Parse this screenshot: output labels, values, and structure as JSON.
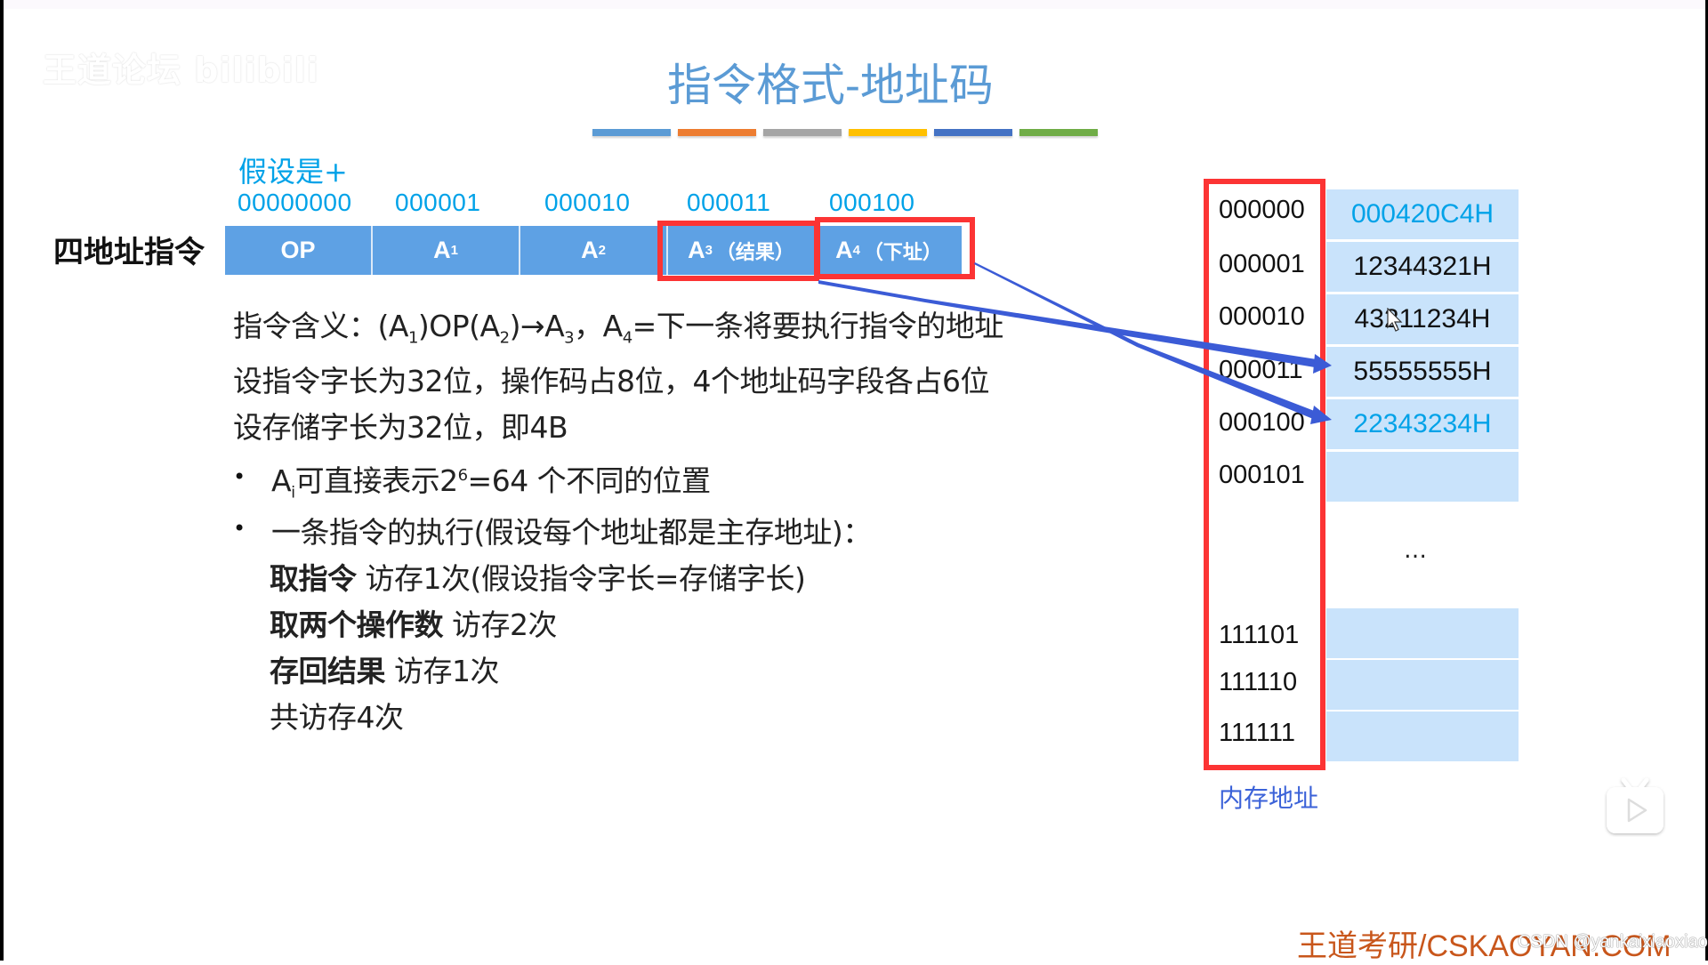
{
  "watermark_logo": "王道论坛 bilibili",
  "title": "指令格式-地址码",
  "color_bars": [
    "#5b9bd5",
    "#ed7d31",
    "#a5a5a5",
    "#ffc000",
    "#4472c4",
    "#70ad47"
  ],
  "instruction": {
    "assume_label": "假设是+",
    "row_label": "四地址指令",
    "bit_values": [
      "00000000",
      "000001",
      "000010",
      "000011",
      "000100"
    ],
    "fields": [
      {
        "main": "OP",
        "sub": "",
        "note": ""
      },
      {
        "main": "A",
        "sub": "1",
        "note": ""
      },
      {
        "main": "A",
        "sub": "2",
        "note": ""
      },
      {
        "main": "A",
        "sub": "3",
        "note": "（结果）"
      },
      {
        "main": "A",
        "sub": "4",
        "note": "（下址）"
      }
    ]
  },
  "text": {
    "meaning_prefix": "指令含义：(A",
    "meaning_s1": "1",
    "meaning_mid1": ")OP(A",
    "meaning_s2": "2",
    "meaning_mid2": ")→A",
    "meaning_s3": "3",
    "meaning_mid3": "，A",
    "meaning_s4": "4",
    "meaning_suffix": "=下一条将要执行指令的地址",
    "line2": "设指令字长为32位，操作码占8位，4个地址码字段各占6位",
    "line3": "设存储字长为32位，即4B",
    "bullet1_a": "A",
    "bullet1_sub": "i",
    "bullet1_b": "可直接表示2",
    "bullet1_sup": "6",
    "bullet1_c": "=64 个不同的位置",
    "bullet2": "一条指令的执行(假设每个地址都是主存地址)：",
    "steps": [
      {
        "bold": "取指令",
        "rest": " 访存1次(假设指令字长=存储字长)"
      },
      {
        "bold": "取两个操作数",
        "rest": " 访存2次"
      },
      {
        "bold": "存回结果",
        "rest": " 访存1次"
      },
      {
        "bold": "",
        "rest": "共访存4次"
      }
    ],
    "bullet_symbol": "•"
  },
  "memory": {
    "rows": [
      {
        "addr": "000000",
        "value": "000420C4H",
        "highlight": true
      },
      {
        "addr": "000001",
        "value": "12344321H",
        "highlight": false
      },
      {
        "addr": "000010",
        "value": "43211234H",
        "highlight": false
      },
      {
        "addr": "000011",
        "value": "55555555H",
        "highlight": false
      },
      {
        "addr": "000100",
        "value": "22343234H",
        "highlight": true
      },
      {
        "addr": "000101",
        "value": "",
        "highlight": false
      },
      {
        "addr": "111101",
        "value": "",
        "highlight": false
      },
      {
        "addr": "111110",
        "value": "",
        "highlight": false
      },
      {
        "addr": "111111",
        "value": "",
        "highlight": false
      }
    ],
    "ellipsis": "…",
    "caption": "内存地址"
  },
  "colors": {
    "accent_blue": "#00a2e8",
    "field_blue": "#5ea1e4",
    "highlight_red": "#fc3434",
    "arrow_blue": "#3b5bd6",
    "memory_cell": "#c9e3fb",
    "brand_orange": "#c8561b"
  },
  "footer": {
    "brand": "王道考研/CSKAOYAN.COM",
    "csdn": "CSDN @yankaixiaoxiao"
  },
  "icons": {
    "player": "tv-play-icon",
    "cursor": "mouse-pointer-icon"
  }
}
